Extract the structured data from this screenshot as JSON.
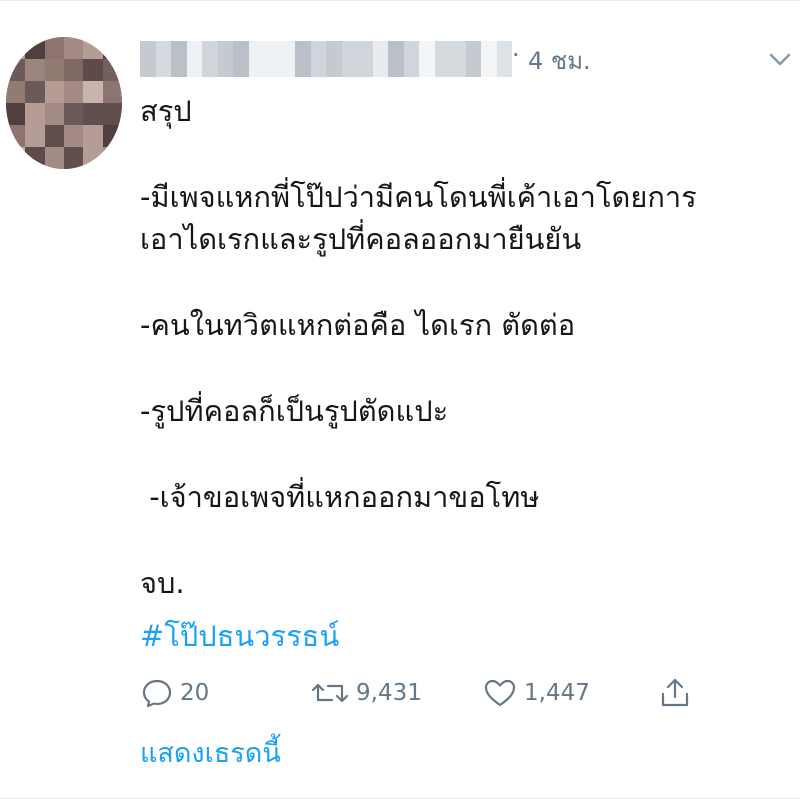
{
  "tweet": {
    "time": "4 ชม.",
    "separator": "·",
    "lines": [
      "สรุป",
      "-มีเพจแหกพี่โป๊ปว่ามีคนโดนพี่เค้าเอาโดยการ",
      "เอาไดเรกและรูปที่คอลออกมายืนยัน",
      "-คนในทวิตแหกต่อคือ ไดเรก ตัดต่อ",
      "-รูปที่คอลก็เป็นรูปตัดแปะ",
      " -เจ้าขอเพจที่แหกออกมาขอโทษ",
      "จบ."
    ],
    "hashtag": "#โป๊ปธนวรรธน์",
    "actions": {
      "reply_count": "20",
      "retweet_count": "9,431",
      "like_count": "1,447"
    },
    "show_thread": "แสดงเธรดนี้"
  },
  "colors": {
    "accent": "#1da1f2",
    "muted": "#657786",
    "text": "#14171a"
  },
  "icons": [
    "reply-icon",
    "retweet-icon",
    "like-icon",
    "share-icon",
    "chevron-down-icon"
  ]
}
